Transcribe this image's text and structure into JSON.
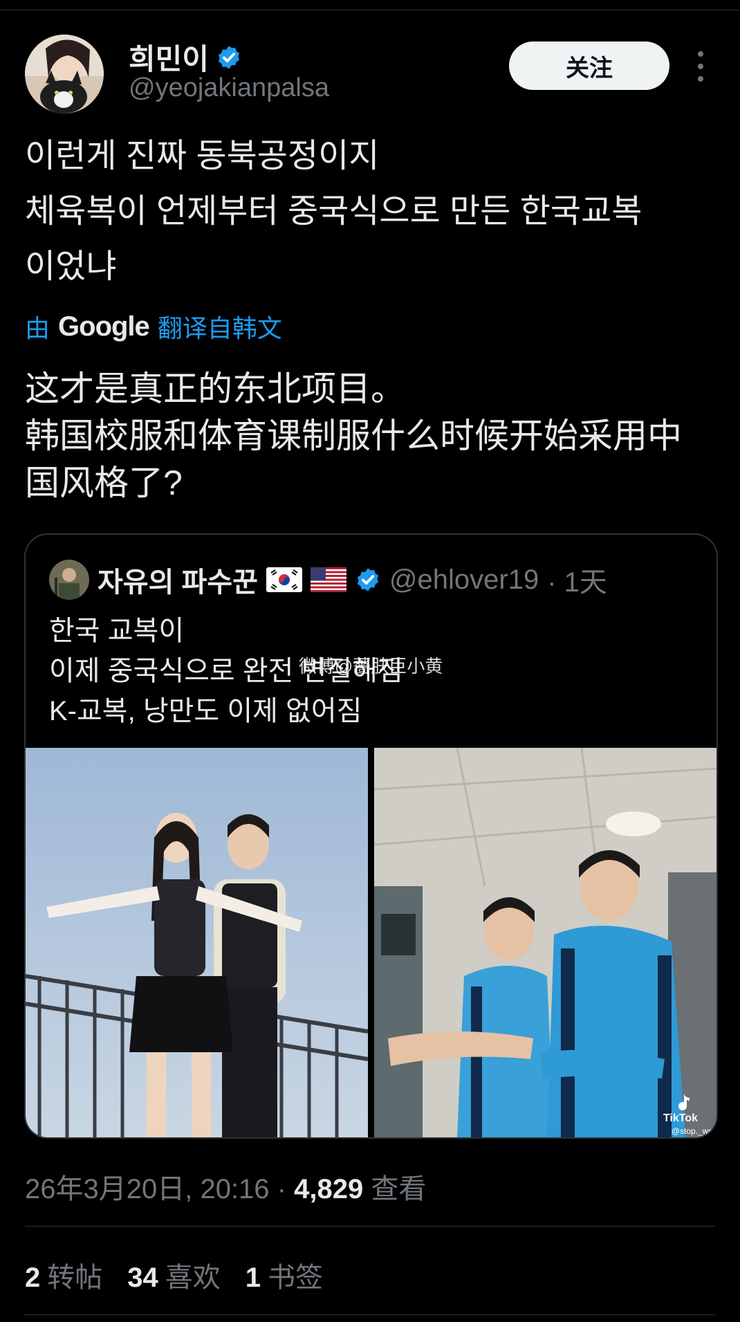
{
  "author": {
    "display_name": "희민이",
    "handle": "@yeojakianpalsa",
    "follow_label": "关注"
  },
  "tweet": {
    "original_lines": [
      "이런게 진짜 동북공정이지",
      "체육복이 언제부터 중국식으로 만든 한국교복",
      "이었냐"
    ],
    "translate_prefix": "由",
    "translate_brand": "Google",
    "translate_suffix": "翻译自韩文",
    "translated_lines": [
      "这才是真正的东北项目。",
      "韩国校服和体育课制服什么时候开始采用中",
      "国风格了?"
    ]
  },
  "quoted": {
    "display_name": "자유의 파수꾼",
    "handle": "@ehlover19",
    "time": "· 1天",
    "lines": [
      "한국 교복이",
      "이제 중국식으로 완전 변질해짐",
      "K-교복, 낭만도 이제 없어짐"
    ],
    "watermark": "微博@薔肤臣小黄",
    "tiktok_label": "TikTok",
    "tiktok_user": "@stop._wo"
  },
  "meta": {
    "timestamp": "26年3月20日, 20:16 ·",
    "views_count": "4,829",
    "views_label": "查看"
  },
  "stats": {
    "reposts_count": "2",
    "reposts_label": "转帖",
    "likes_count": "34",
    "likes_label": "喜欢",
    "bookmarks_count": "1",
    "bookmarks_label": "书签"
  },
  "colors": {
    "accent": "#1d9bf0",
    "muted": "#71767b",
    "text": "#e7e9ea",
    "background": "#000000"
  }
}
